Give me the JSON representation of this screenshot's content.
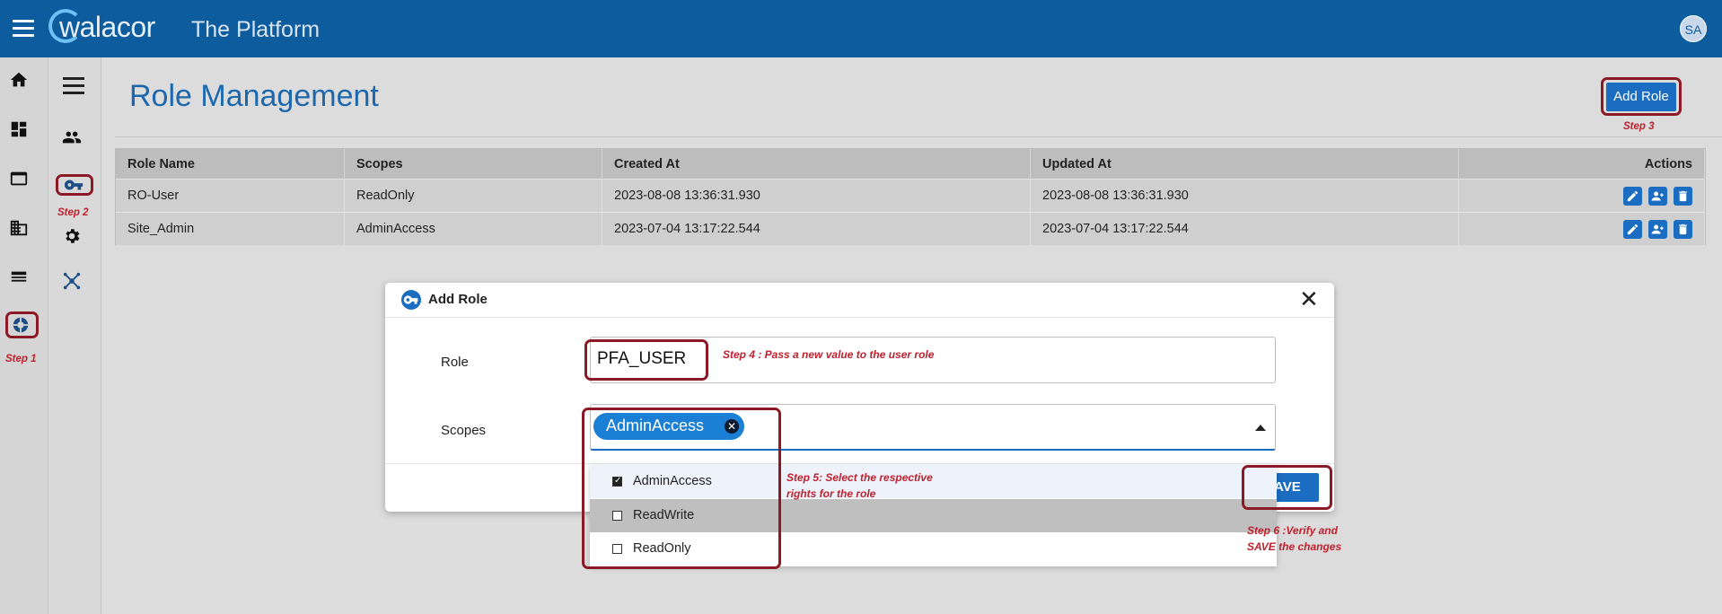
{
  "header": {
    "logo_text": "walacor",
    "app_title": "The Platform",
    "avatar_initials": "SA"
  },
  "page": {
    "title": "Role Management",
    "add_role_label": "Add Role"
  },
  "steps": {
    "step1": "Step 1",
    "step2": "Step 2",
    "step3": "Step 3",
    "step4": "Step 4 : Pass a new value to the user role",
    "step5_line1": "Step 5: Select the respective",
    "step5_line2": "rights for the role",
    "step6_line1": "Step 6 :Verify and",
    "step6_line2": "SAVE the changes"
  },
  "table": {
    "headers": [
      "Role Name",
      "Scopes",
      "Created At",
      "Updated At",
      "Actions"
    ],
    "rows": [
      [
        "RO-User",
        "ReadOnly",
        "2023-08-08 13:36:31.930",
        "2023-08-08 13:36:31.930"
      ],
      [
        "Site_Admin",
        "AdminAccess",
        "2023-07-04 13:17:22.544",
        "2023-07-04 13:17:22.544"
      ]
    ]
  },
  "modal": {
    "title": "Add Role",
    "close_glyph": "✕",
    "role_label": "Role",
    "role_value": "PFA_USER",
    "scopes_label": "Scopes",
    "selected_chip": "AdminAccess",
    "chip_remove_glyph": "✕",
    "save_label": "AVE",
    "options": [
      {
        "label": "AdminAccess",
        "checked": true
      },
      {
        "label": "ReadWrite",
        "checked": false
      },
      {
        "label": "ReadOnly",
        "checked": false
      }
    ]
  },
  "colors": {
    "topbar": "#0d5c9e",
    "accent": "#1b6dc1",
    "annotation": "#c0202d",
    "annotation_box": "#8c1a26"
  }
}
